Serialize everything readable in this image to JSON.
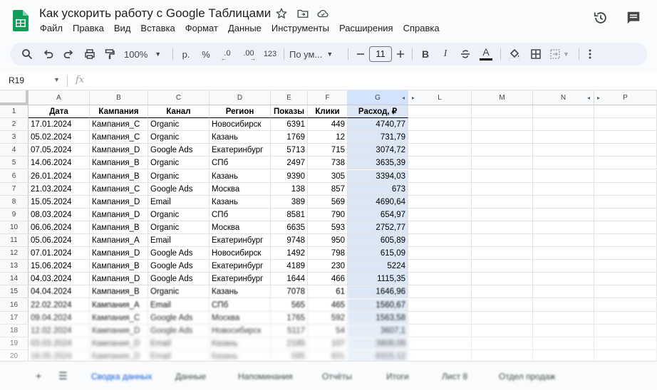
{
  "window": {
    "title": "Как ускорить работу с Google Таблицами"
  },
  "menu": [
    "Файл",
    "Правка",
    "Вид",
    "Вставка",
    "Формат",
    "Данные",
    "Инструменты",
    "Расширения",
    "Справка"
  ],
  "toolbar": {
    "zoom": "100%",
    "currency": "р.",
    "percent": "%",
    "decrease_decimals": ".0",
    "increase_decimals": ".00",
    "number_format": "123",
    "font": "По ум...",
    "font_size": "11",
    "bold": "B",
    "italic": "I",
    "text_color": "A"
  },
  "formula_bar": {
    "cell_ref": "R19",
    "fx": "fx"
  },
  "columns": [
    "A",
    "B",
    "C",
    "D",
    "E",
    "F",
    "G",
    "L",
    "M",
    "N",
    "P"
  ],
  "table": {
    "headers": [
      "Дата",
      "Кампания",
      "Канал",
      "Регион",
      "Показы",
      "Клики",
      "Расход, ₽"
    ],
    "rows": [
      [
        "17.01.2024",
        "Кампания_C",
        "Organic",
        "Новосибирск",
        "6391",
        "449",
        "4740,77"
      ],
      [
        "05.02.2024",
        "Кампания_C",
        "Organic",
        "Казань",
        "1769",
        "12",
        "731,79"
      ],
      [
        "07.05.2024",
        "Кампания_D",
        "Google Ads",
        "Екатеринбург",
        "5713",
        "715",
        "3074,72"
      ],
      [
        "14.06.2024",
        "Кампания_B",
        "Organic",
        "СПб",
        "2497",
        "738",
        "3635,39"
      ],
      [
        "26.01.2024",
        "Кампания_B",
        "Organic",
        "Казань",
        "9390",
        "305",
        "3394,03"
      ],
      [
        "21.03.2024",
        "Кампания_C",
        "Google Ads",
        "Москва",
        "138",
        "857",
        "673"
      ],
      [
        "15.05.2024",
        "Кампания_D",
        "Email",
        "Казань",
        "389",
        "569",
        "4690,64"
      ],
      [
        "08.03.2024",
        "Кампания_D",
        "Organic",
        "СПб",
        "8581",
        "790",
        "654,97"
      ],
      [
        "06.06.2024",
        "Кампания_B",
        "Organic",
        "Москва",
        "6635",
        "593",
        "2752,77"
      ],
      [
        "05.06.2024",
        "Кампания_A",
        "Email",
        "Екатеринбург",
        "9748",
        "950",
        "605,89"
      ],
      [
        "07.01.2024",
        "Кампания_D",
        "Google Ads",
        "Новосибирск",
        "1492",
        "798",
        "615,09"
      ],
      [
        "15.06.2024",
        "Кампания_B",
        "Google Ads",
        "Екатеринбург",
        "4189",
        "230",
        "5224"
      ],
      [
        "04.03.2024",
        "Кампания_D",
        "Google Ads",
        "Екатеринбург",
        "1644",
        "466",
        "1115,35"
      ],
      [
        "04.04.2024",
        "Кампания_B",
        "Organic",
        "Казань",
        "7078",
        "61",
        "1646,96"
      ],
      [
        "22.02.2024",
        "Кампания_A",
        "Email",
        "СПб",
        "565",
        "465",
        "1560,67"
      ],
      [
        "09.04.2024",
        "Кампания_C",
        "Google Ads",
        "Москва",
        "1765",
        "592",
        "1563,58"
      ],
      [
        "12.02.2024",
        "Кампания_D",
        "Google Ads",
        "Новосибирск",
        "5117",
        "54",
        "3607,1"
      ],
      [
        "03.03.2024",
        "Кампания_D",
        "Email",
        "Казань",
        "2185",
        "107",
        "3808,09"
      ],
      [
        "18.05.2024",
        "Кампания_D",
        "Email",
        "Казань",
        "595",
        "831",
        "6315,12"
      ]
    ]
  },
  "sheet_tabs": [
    "Сводка данных",
    "Данные",
    "Напоминания",
    "Отчёты",
    "Итоги",
    "Лист 8",
    "Отдел продаж"
  ],
  "colors": {
    "accent": "#0b57d0",
    "selected_column": "#dce7f5",
    "sheets_green": "#0f9d58"
  }
}
